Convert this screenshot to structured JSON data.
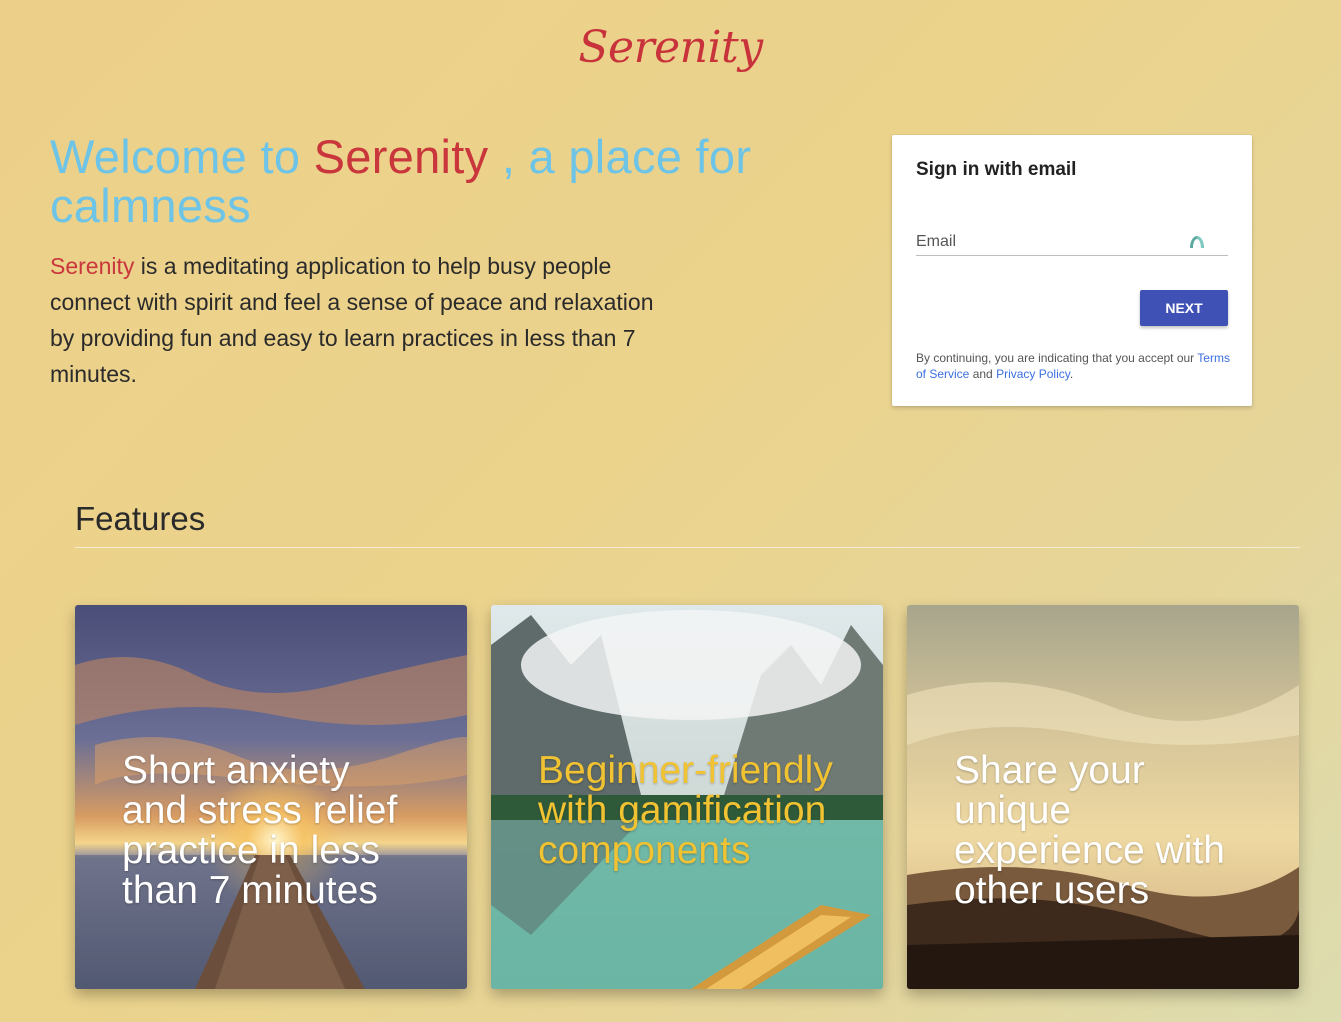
{
  "brand": {
    "logo_text": "Serenity",
    "color": "#c8323a"
  },
  "hero": {
    "title_part1": "Welcome to ",
    "title_accent": "Serenity",
    "title_part2": " , a place for calmness",
    "desc_accent": "Serenity",
    "desc_rest": " is a meditating application to help busy people connect with spirit and feel a sense of peace and relaxation by providing fun and easy to learn practices in less than 7 minutes."
  },
  "signin": {
    "title": "Sign in with email",
    "email_placeholder": "Email",
    "next_label": "NEXT",
    "legal_prefix": "By continuing, you are indicating that you accept our ",
    "terms_label": "Terms of Service",
    "legal_and": " and ",
    "privacy_label": "Privacy Policy",
    "legal_suffix": "."
  },
  "features": {
    "title": "Features",
    "cards": [
      {
        "text": "Short anxiety and stress relief practice in less than 7 minutes",
        "scene": "sunset-pier"
      },
      {
        "text": "Beginner-friendly with gamification components",
        "scene": "mountain-lake-boat"
      },
      {
        "text": "Share your unique experience with other users",
        "scene": "hazy-hills"
      }
    ]
  },
  "colors": {
    "accent_red": "#c9363c",
    "accent_blue": "#6ec4e6",
    "button": "#3f51b5",
    "link": "#3b6fe0",
    "card_gold_text": "#f1c232"
  }
}
